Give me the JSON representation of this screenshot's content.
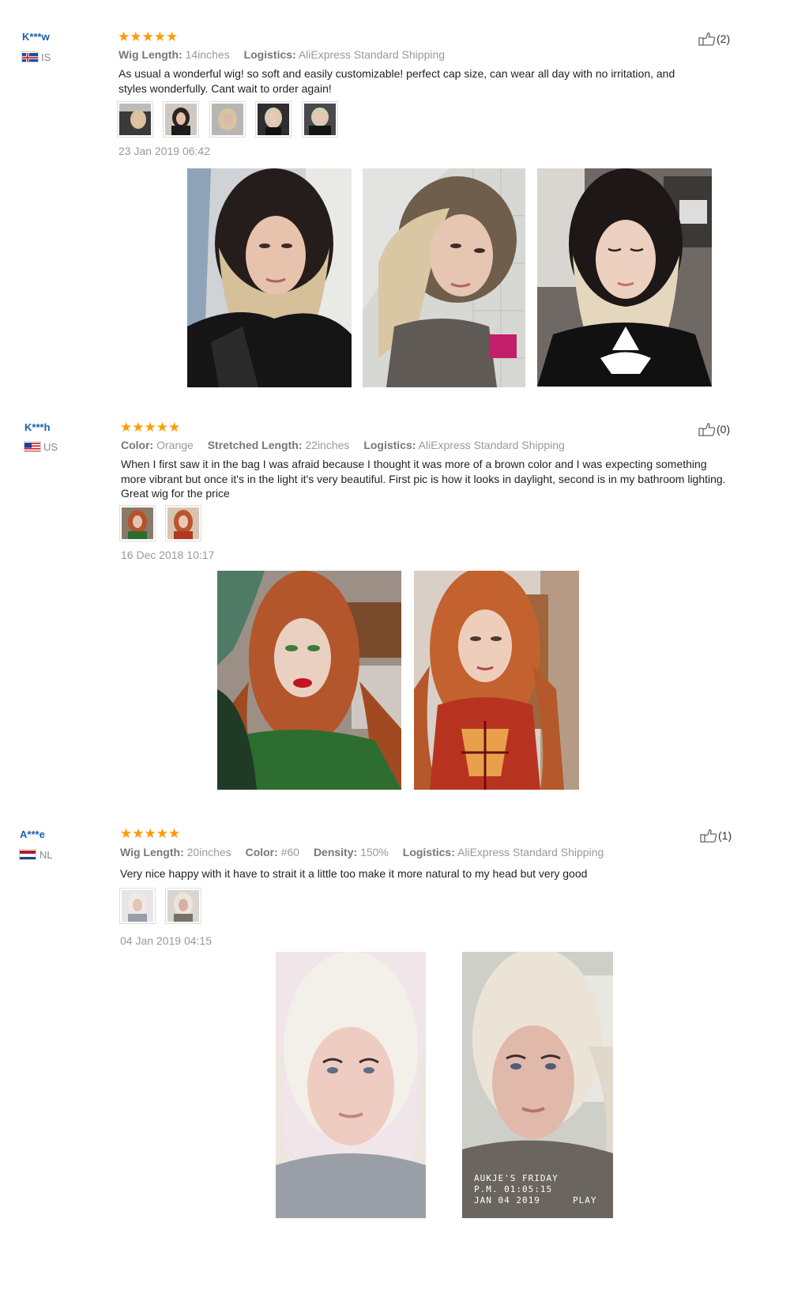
{
  "reviews": [
    {
      "user": "K***w",
      "country": "IS",
      "helpful_count": "(2)",
      "attributes": [
        {
          "label": "Wig Length:",
          "value": "14inches"
        },
        {
          "label": "Logistics:",
          "value": "AliExpress Standard Shipping"
        }
      ],
      "text": "As usual a wonderful wig! so soft and easily customizable! perfect cap size, can wear all day with no irritation, and styles wonderfully. Cant wait to order again!",
      "date": "23 Jan 2019 06:42",
      "rating": 5
    },
    {
      "user": "K***h",
      "country": "US",
      "helpful_count": "(0)",
      "attributes": [
        {
          "label": "Color:",
          "value": "Orange"
        },
        {
          "label": "Stretched Length:",
          "value": "22inches"
        },
        {
          "label": "Logistics:",
          "value": "AliExpress Standard Shipping"
        }
      ],
      "text": "When I first saw it in the bag I was afraid because I thought it was more of a brown color and I was expecting something more vibrant but once it's in the light it's very beautiful. First pic is how it looks in daylight, second is in my bathroom lighting. Great wig for the price",
      "date": "16 Dec 2018 10:17",
      "rating": 5
    },
    {
      "user": "A***e",
      "country": "NL",
      "helpful_count": "(1)",
      "attributes": [
        {
          "label": "Wig Length:",
          "value": "20inches"
        },
        {
          "label": "Color:",
          "value": "#60"
        },
        {
          "label": "Density:",
          "value": "150%"
        },
        {
          "label": "Logistics:",
          "value": "AliExpress Standard Shipping"
        }
      ],
      "text": "Very nice happy with it have to strait it a little too make it more natural to my head but very good",
      "date": "04 Jan 2019 04:15",
      "rating": 5
    }
  ],
  "photo_overlay": {
    "line1": "AUKJE'S FRIDAY",
    "line2": "P.M. 01:05:15",
    "line3": "JAN 04 2019",
    "play": "PLAY"
  },
  "colors": {
    "username": "#1a5fb4",
    "star": "#ff9a00",
    "meta": "#999999"
  },
  "icons": {
    "star": "star-icon",
    "like": "thumbs-up-icon"
  }
}
